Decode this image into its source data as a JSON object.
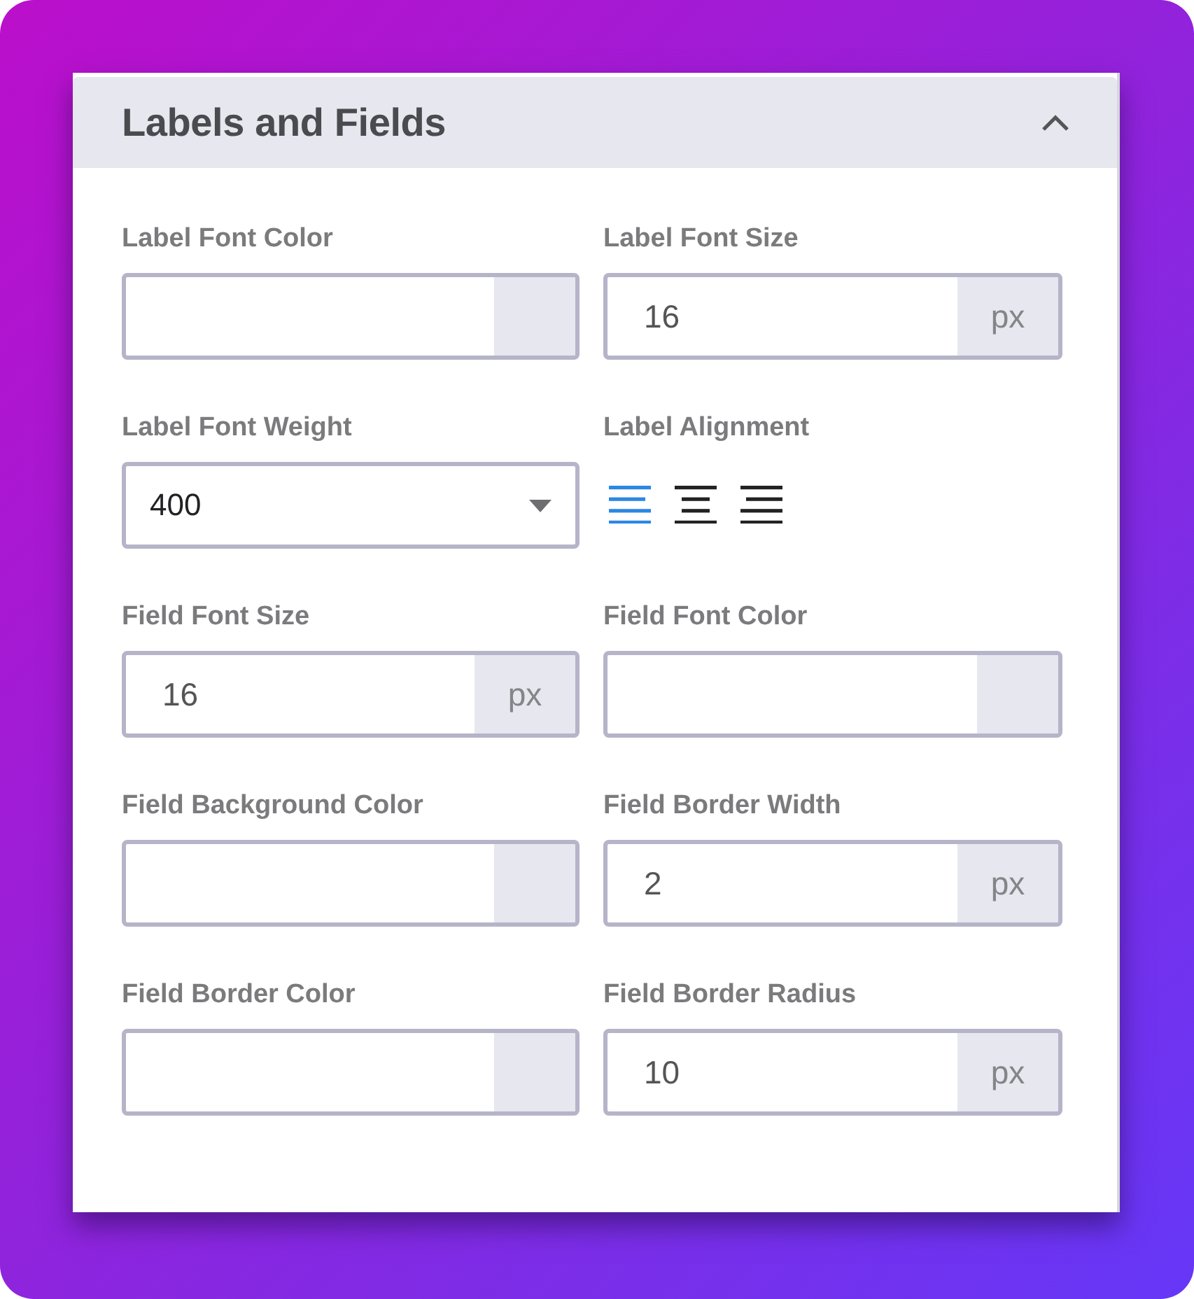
{
  "panel": {
    "title": "Labels and Fields",
    "expanded": true
  },
  "fields": [
    {
      "kind": "color",
      "label": "Label Font Color"
    },
    {
      "kind": "number",
      "label": "Label Font Size",
      "value": "16",
      "unit": "px"
    },
    {
      "kind": "select",
      "label": "Label Font Weight",
      "value": "400"
    },
    {
      "kind": "alignment",
      "label": "Label Alignment",
      "options": [
        {
          "kind": "left",
          "selected": true
        },
        {
          "kind": "center",
          "selected": false
        },
        {
          "kind": "right",
          "selected": false
        }
      ]
    },
    {
      "kind": "number",
      "label": "Field Font Size",
      "value": "16",
      "unit": "px"
    },
    {
      "kind": "color",
      "label": "Field Font Color"
    },
    {
      "kind": "color",
      "label": "Field Background Color"
    },
    {
      "kind": "number",
      "label": "Field Border Width",
      "value": "2",
      "unit": "px"
    },
    {
      "kind": "color",
      "label": "Field Border Color"
    },
    {
      "kind": "number",
      "label": "Field Border Radius",
      "value": "10",
      "unit": "px"
    }
  ]
}
